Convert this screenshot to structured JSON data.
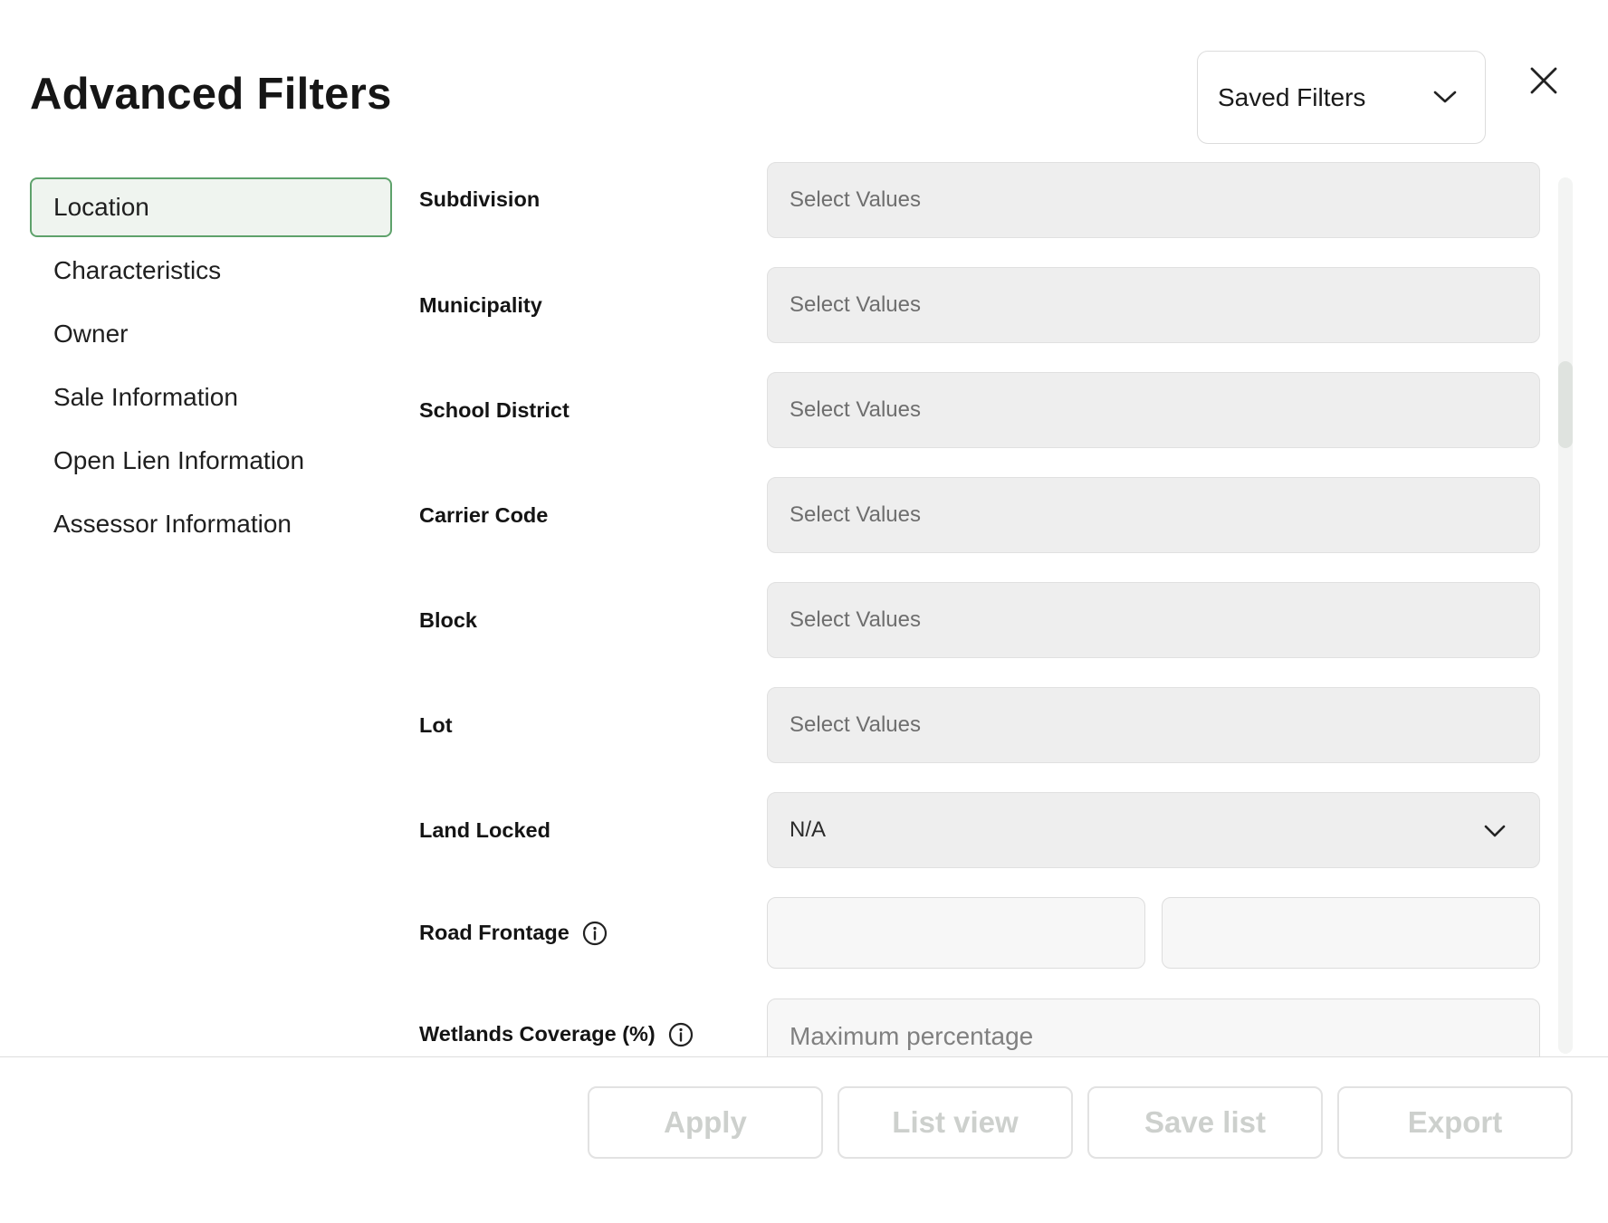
{
  "header": {
    "title": "Advanced Filters",
    "saved_filters_label": "Saved Filters",
    "close_icon": "close-icon"
  },
  "sidebar": {
    "items": [
      {
        "label": "Location",
        "active": true
      },
      {
        "label": "Characteristics",
        "active": false
      },
      {
        "label": "Owner",
        "active": false
      },
      {
        "label": "Sale Information",
        "active": false
      },
      {
        "label": "Open Lien Information",
        "active": false
      },
      {
        "label": "Assessor Information",
        "active": false
      }
    ]
  },
  "fields": {
    "subdivision": {
      "label": "Subdivision",
      "placeholder": "Select Values"
    },
    "municipality": {
      "label": "Municipality",
      "placeholder": "Select Values"
    },
    "school_district": {
      "label": "School District",
      "placeholder": "Select Values"
    },
    "carrier_code": {
      "label": "Carrier Code",
      "placeholder": "Select Values"
    },
    "block": {
      "label": "Block",
      "placeholder": "Select Values"
    },
    "lot": {
      "label": "Lot",
      "placeholder": "Select Values"
    },
    "land_locked": {
      "label": "Land Locked",
      "value": "N/A"
    },
    "road_frontage": {
      "label": "Road Frontage",
      "min_value": "",
      "max_value": ""
    },
    "wetlands_coverage": {
      "label": "Wetlands Coverage (%)",
      "placeholder": "Maximum percentage"
    }
  },
  "footer": {
    "apply_label": "Apply",
    "list_view_label": "List view",
    "save_list_label": "Save list",
    "export_label": "Export"
  },
  "colors": {
    "accent": "#5ea26b",
    "active_bg": "#eff4ef",
    "field_bg": "#eeeeee",
    "disabled_text": "#cdd0cd"
  }
}
